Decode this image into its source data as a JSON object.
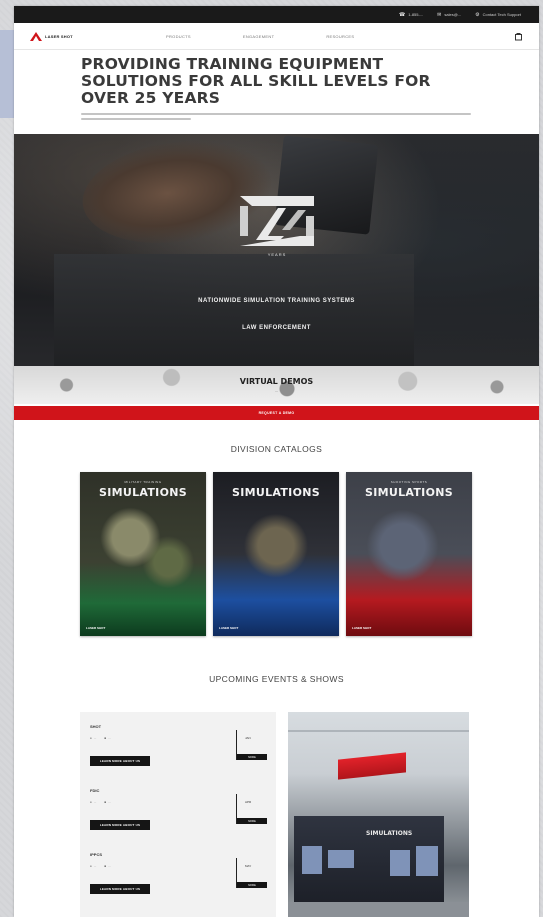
{
  "topbar": {
    "phone": "1-855-...",
    "email": "sales@...",
    "contact": "Contact Tech Support"
  },
  "nav": {
    "logo": "LASER SHOT",
    "menu": [
      "PRODUCTS",
      "ENGAGEMENT",
      "RESOURCES"
    ]
  },
  "heading": {
    "title": "PROVIDING TRAINING EQUIPMENT SOLUTIONS FOR ALL SKILL LEVELS FOR OVER 25 YEARS"
  },
  "hero": {
    "badge": "YEARS",
    "line1": "NATIONWIDE SIMULATION TRAINING SYSTEMS",
    "line2": "LAW ENFORCEMENT",
    "demo_title": "VIRTUAL DEMOS",
    "demo_sub": "...",
    "cta": "REQUEST A DEMO"
  },
  "catalogs": {
    "title": "DIVISION CATALOGS",
    "items": [
      {
        "top": "MILITARY TRAINING",
        "name": "SIMULATIONS",
        "foot": "LASER SHOT",
        "accent": "#1f6a38"
      },
      {
        "top": "",
        "name": "SIMULATIONS",
        "foot": "LASER SHOT",
        "accent": "#1d4fa0"
      },
      {
        "top": "SHOOTING SPORTS",
        "name": "SIMULATIONS",
        "foot": "LASER SHOT",
        "accent": "#b51a20"
      }
    ]
  },
  "events": {
    "title": "UPCOMING EVENTS & SHOWS",
    "items": [
      {
        "name": "SHOT",
        "loc": "...",
        "date_text": "...",
        "cta": "LEARN MORE ABOUT US",
        "month": "JAN",
        "more": "MORE"
      },
      {
        "name": "FDIC",
        "loc": "...",
        "date_text": "...",
        "cta": "LEARN MORE ABOUT US",
        "month": "APR",
        "more": "MORE"
      },
      {
        "name": "IPPCS",
        "loc": "...",
        "date_text": "...",
        "cta": "LEARN MORE ABOUT US",
        "month": "MAY",
        "more": "MORE"
      }
    ],
    "booth_title": "SIMULATIONS"
  },
  "colors": {
    "accent_red": "#d0141a",
    "dark": "#1a1a1a"
  }
}
